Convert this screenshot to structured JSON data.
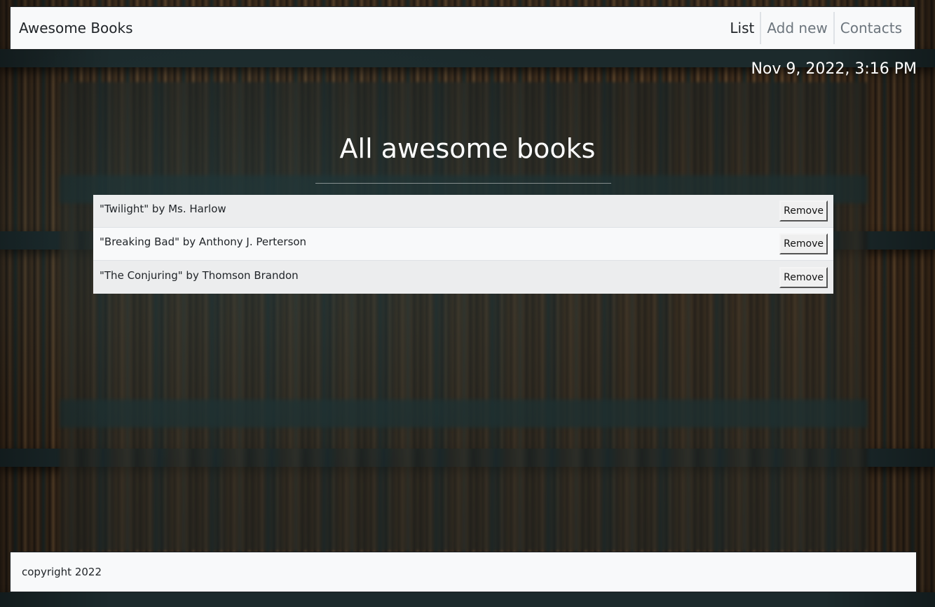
{
  "navbar": {
    "brand": "Awesome Books",
    "links": [
      {
        "label": "List",
        "active": true
      },
      {
        "label": "Add new",
        "active": false
      },
      {
        "label": "Contacts",
        "active": false
      }
    ]
  },
  "datetime": "Nov 9, 2022, 3:16 PM",
  "main": {
    "heading": "All awesome books",
    "books": [
      {
        "text": "\"Twilight\" by Ms. Harlow",
        "button_label": "Remove"
      },
      {
        "text": "\"Breaking Bad\" by Anthony J. Perterson",
        "button_label": "Remove"
      },
      {
        "text": "\"The Conjuring\" by Thomson Brandon",
        "button_label": "Remove"
      }
    ]
  },
  "footer": {
    "text": "copyright 2022"
  },
  "colors": {
    "navbar_bg": "#f8f9fa",
    "row_odd_bg": "#ecedee",
    "row_even_bg": "#f8f9fa",
    "heading_text": "#ffffff"
  }
}
